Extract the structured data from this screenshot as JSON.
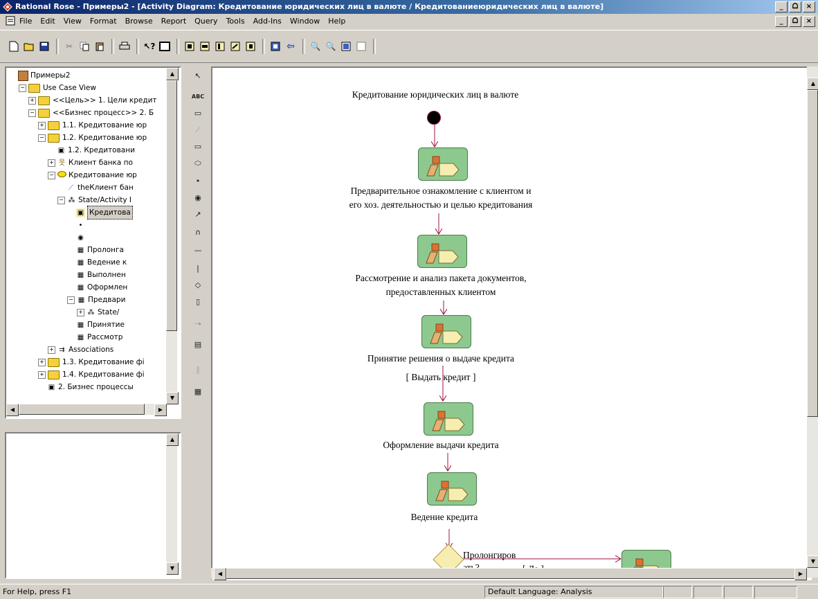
{
  "window": {
    "title": "Rational Rose - Примеры2 - [Activity Diagram: Кредитование юридических лиц в валюте / Кредитованиеюридических лиц в валюте]",
    "minimize": "_",
    "restore": "ᗝ",
    "close": "×"
  },
  "menu": [
    "File",
    "Edit",
    "View",
    "Format",
    "Browse",
    "Report",
    "Query",
    "Tools",
    "Add-Ins",
    "Window",
    "Help"
  ],
  "tree": [
    {
      "label": "Примеры2",
      "indent": 0,
      "icon": "model-icon",
      "exp": ""
    },
    {
      "label": "Use Case View",
      "indent": 1,
      "icon": "folder",
      "exp": "−"
    },
    {
      "label": "<<Цель>> 1. Цели кредит",
      "indent": 2,
      "icon": "folder",
      "exp": "+"
    },
    {
      "label": "<<Бизнес процесс>> 2. Б",
      "indent": 2,
      "icon": "folder",
      "exp": "−"
    },
    {
      "label": "1.1. Кредитование юр",
      "indent": 3,
      "icon": "folder",
      "exp": "+"
    },
    {
      "label": "1.2. Кредитование юр",
      "indent": 3,
      "icon": "folder",
      "exp": "−"
    },
    {
      "label": "1.2. Кредитовани",
      "indent": 4,
      "icon": "diagram-icon",
      "exp": ""
    },
    {
      "label": "Клиент банка по",
      "indent": 4,
      "icon": "actor-icon",
      "exp": "+"
    },
    {
      "label": "Кредитование юр",
      "indent": 4,
      "icon": "usecase-icon",
      "exp": "−"
    },
    {
      "label": "theКлиент бан",
      "indent": 5,
      "icon": "association-icon",
      "exp": ""
    },
    {
      "label": "State/Activity I",
      "indent": 5,
      "icon": "state-icon",
      "exp": "−"
    },
    {
      "label": "Кредитова",
      "indent": 6,
      "icon": "activity-diagram-icon",
      "exp": "",
      "selected": true
    },
    {
      "label": "",
      "indent": 6,
      "icon": "start-dot-icon",
      "exp": ""
    },
    {
      "label": "",
      "indent": 6,
      "icon": "end-dot-icon",
      "exp": ""
    },
    {
      "label": "Пролонга",
      "indent": 6,
      "icon": "activity-icon",
      "exp": ""
    },
    {
      "label": "Ведение к",
      "indent": 6,
      "icon": "activity-icon",
      "exp": ""
    },
    {
      "label": "Выполнен",
      "indent": 6,
      "icon": "activity-icon",
      "exp": ""
    },
    {
      "label": "Оформлен",
      "indent": 6,
      "icon": "activity-icon",
      "exp": ""
    },
    {
      "label": "Предвари",
      "indent": 6,
      "icon": "activity-icon",
      "exp": "−"
    },
    {
      "label": "State/",
      "indent": 7,
      "icon": "state-icon",
      "exp": "+"
    },
    {
      "label": "Принятие",
      "indent": 6,
      "icon": "activity-icon",
      "exp": ""
    },
    {
      "label": "Рассмотр",
      "indent": 6,
      "icon": "activity-icon",
      "exp": ""
    },
    {
      "label": "Associations",
      "indent": 4,
      "icon": "associations-icon",
      "exp": "+"
    },
    {
      "label": "1.3. Кредитование фі",
      "indent": 3,
      "icon": "folder",
      "exp": "+"
    },
    {
      "label": "1.4. Кредитование фі",
      "indent": 3,
      "icon": "folder",
      "exp": "+"
    },
    {
      "label": "2. Бизнес процессы",
      "indent": 3,
      "icon": "diagram-icon",
      "exp": ""
    }
  ],
  "diagram": {
    "title": "Кредитование юридических лиц в валюте",
    "act1_line1": "Предварительное ознакомление с клиентом и",
    "act1_line2": "его хоз. деятельностью и целью кредитования",
    "act2_line1": "Рассмотрение и анализ пакета документов,",
    "act2_line2": "предоставленных клиентом",
    "act3": "Принятие решения о выдаче кредита",
    "guard1": "[ Выдать кредит ]",
    "act4": "Оформление выдачи кредита",
    "act5": "Ведение кредита",
    "decision_label_1": "Пролонгиров",
    "decision_label_2": "ать?",
    "guard2": "[ Да ]"
  },
  "status": {
    "help": "For Help, press F1",
    "language": "Default Language: Analysis"
  }
}
